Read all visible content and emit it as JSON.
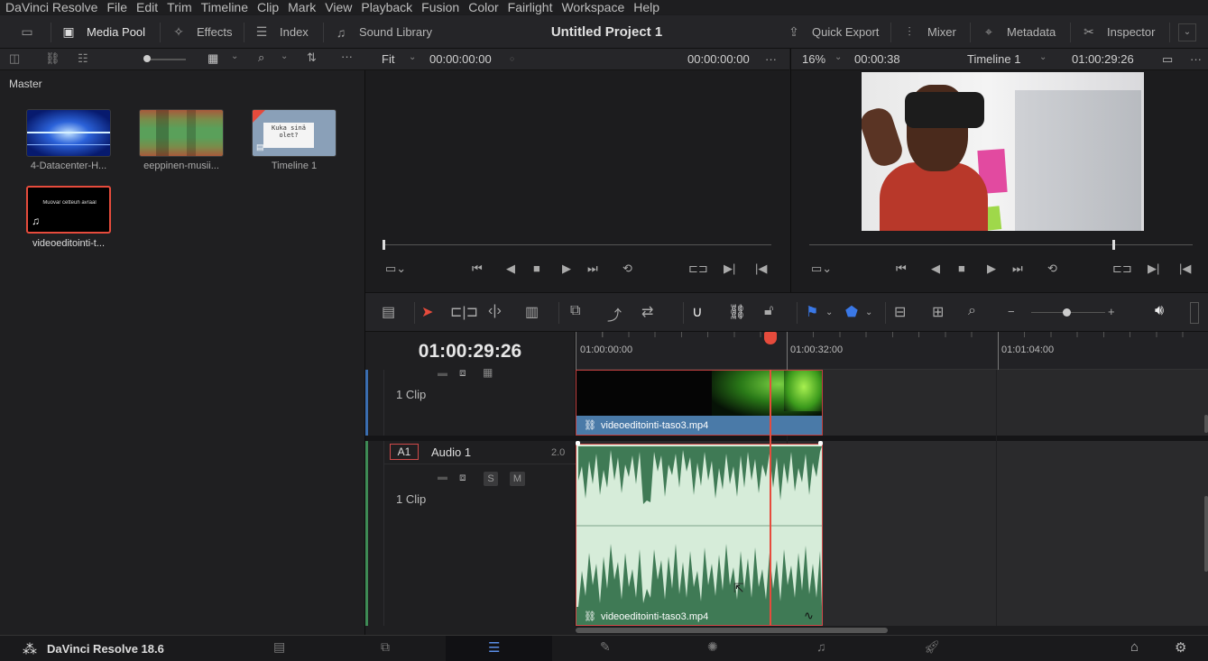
{
  "menu": [
    "DaVinci Resolve",
    "File",
    "Edit",
    "Trim",
    "Timeline",
    "Clip",
    "Mark",
    "View",
    "Playback",
    "Fusion",
    "Color",
    "Fairlight",
    "Workspace",
    "Help"
  ],
  "toolbar": {
    "media_pool": "Media Pool",
    "effects": "Effects",
    "index": "Index",
    "sound_library": "Sound Library",
    "project_title": "Untitled Project 1",
    "quick_export": "Quick Export",
    "mixer": "Mixer",
    "metadata": "Metadata",
    "inspector": "Inspector"
  },
  "media_pool": {
    "bin": "Master",
    "clips": [
      {
        "name": "4-Datacenter-H...",
        "kind": "video"
      },
      {
        "name": "eeppinen-musii...",
        "kind": "audio"
      },
      {
        "name": "Timeline 1",
        "kind": "timeline",
        "overlay_text": "Kuka sinä olet?"
      },
      {
        "name": "videoeditointi-t...",
        "kind": "video-audio",
        "overlay_text": "Muovar cetteuh avraal",
        "selected": true
      }
    ]
  },
  "source_viewer": {
    "zoom": "Fit",
    "timecode_in": "00:00:00:00",
    "timecode_out": "00:00:00:00"
  },
  "timeline_viewer": {
    "zoom": "16%",
    "duration": "00:00:38",
    "timeline_name": "Timeline 1",
    "timecode": "01:00:29:26"
  },
  "timeline": {
    "current_timecode": "01:00:29:26",
    "ruler_labels": [
      "01:00:00:00",
      "01:00:32:00",
      "01:01:04:00"
    ],
    "video_track": {
      "clip_count": "1 Clip",
      "clip_name": "videoeditointi-taso3.mp4"
    },
    "audio_track": {
      "id": "A1",
      "name": "Audio 1",
      "channels": "2.0",
      "clip_count": "1 Clip",
      "solo": "S",
      "mute": "M",
      "clip_name": "videoeditointi-taso3.mp4"
    }
  },
  "footer": {
    "app_version": "DaVinci Resolve 18.6"
  },
  "colors": {
    "accent_red": "#e64b3c",
    "video_clip": "#4a7aa8",
    "audio_clip": "#d6ecd9",
    "audio_wave": "#3f7a55",
    "active_page": "#111114"
  }
}
